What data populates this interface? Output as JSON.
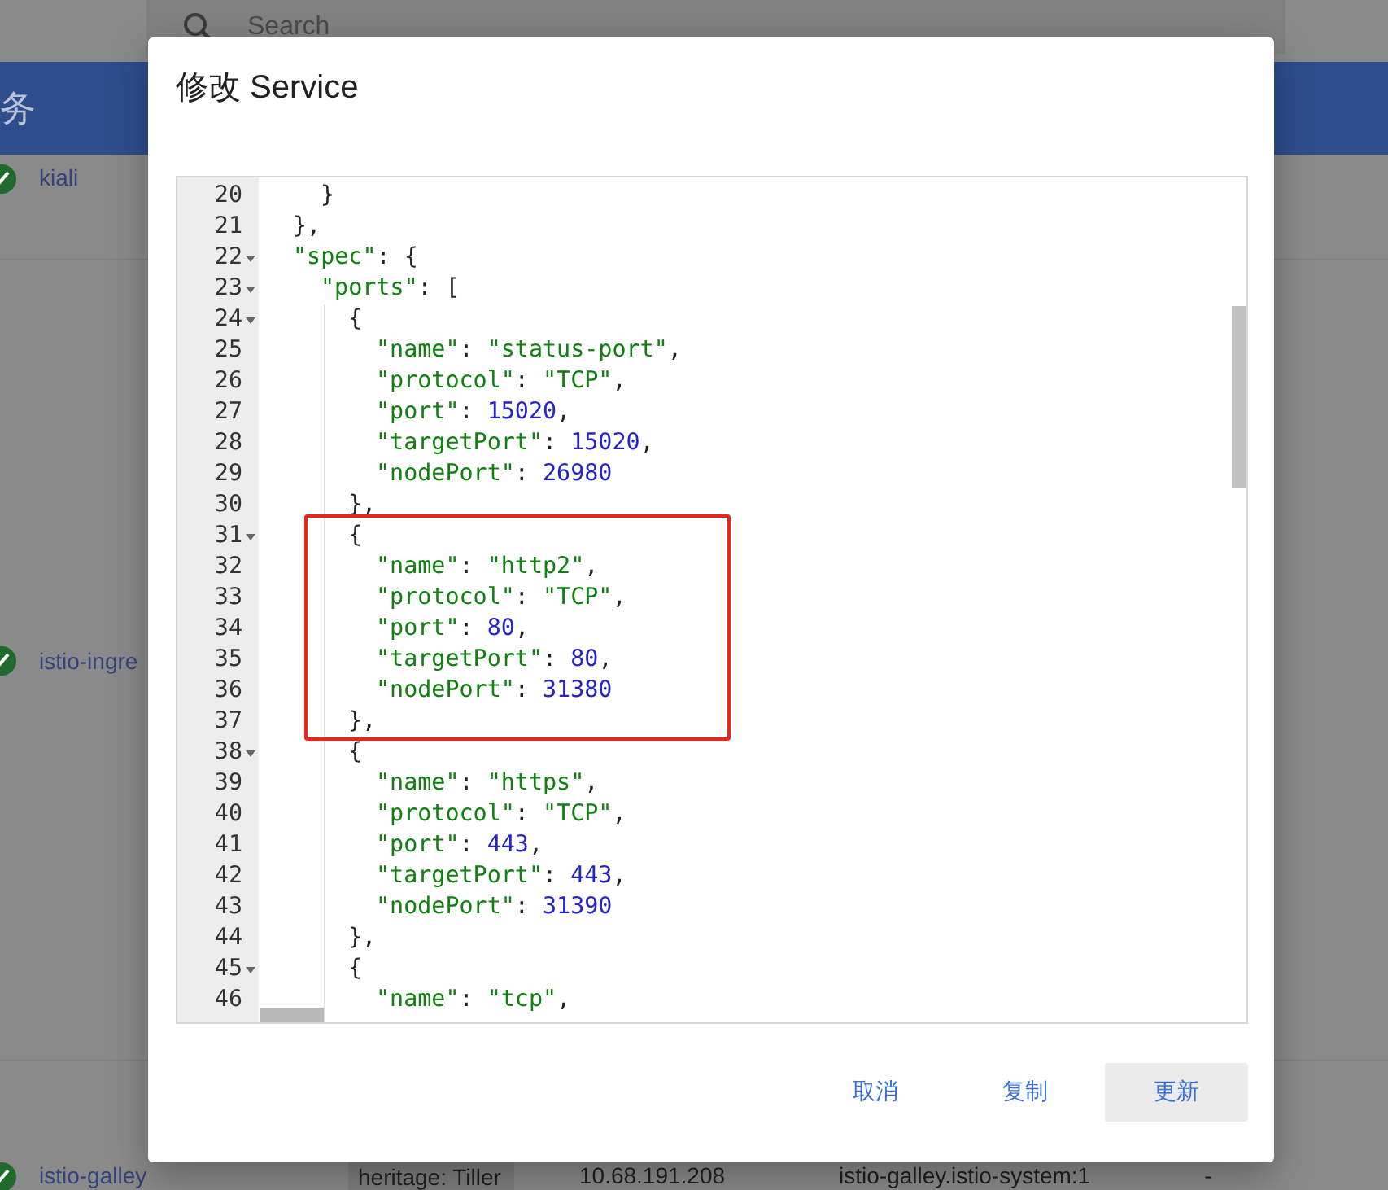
{
  "background": {
    "search": {
      "placeholder": "Search"
    },
    "header": {
      "title": "务"
    },
    "rows": [
      {
        "name": "kiali",
        "cells": []
      },
      {
        "name": "istio-ingre",
        "cells": []
      },
      {
        "name": "istio-galley",
        "cells": [
          {
            "kind": "tag",
            "text": "heritage: Tiller"
          },
          {
            "kind": "text",
            "text": "10.68.191.208"
          },
          {
            "kind": "text",
            "text": "istio-galley.istio-system:1"
          },
          {
            "kind": "text",
            "text": "-"
          }
        ]
      }
    ]
  },
  "dialog": {
    "title": "修改 Service",
    "editor": {
      "lines": [
        {
          "number": "20",
          "fold": false,
          "tokens": [
            {
              "kind": "punct",
              "text": "}"
            }
          ]
        },
        {
          "number": "21",
          "fold": false,
          "tokens": [
            {
              "kind": "punct",
              "text": "},"
            }
          ]
        },
        {
          "number": "22",
          "fold": true,
          "tokens": [
            {
              "kind": "key",
              "text": "\"spec\""
            },
            {
              "kind": "punct",
              "text": ": {"
            }
          ]
        },
        {
          "number": "23",
          "fold": true,
          "tokens": [
            {
              "kind": "key",
              "text": "\"ports\""
            },
            {
              "kind": "punct",
              "text": ": ["
            }
          ]
        },
        {
          "number": "24",
          "fold": true,
          "tokens": [
            {
              "kind": "punct",
              "text": "{"
            }
          ]
        },
        {
          "number": "25",
          "fold": false,
          "tokens": [
            {
              "kind": "key",
              "text": "\"name\""
            },
            {
              "kind": "punct",
              "text": ": "
            },
            {
              "kind": "string",
              "text": "\"status-port\""
            },
            {
              "kind": "punct",
              "text": ","
            }
          ]
        },
        {
          "number": "26",
          "fold": false,
          "tokens": [
            {
              "kind": "key",
              "text": "\"protocol\""
            },
            {
              "kind": "punct",
              "text": ": "
            },
            {
              "kind": "string",
              "text": "\"TCP\""
            },
            {
              "kind": "punct",
              "text": ","
            }
          ]
        },
        {
          "number": "27",
          "fold": false,
          "tokens": [
            {
              "kind": "key",
              "text": "\"port\""
            },
            {
              "kind": "punct",
              "text": ": "
            },
            {
              "kind": "number",
              "text": "15020"
            },
            {
              "kind": "punct",
              "text": ","
            }
          ]
        },
        {
          "number": "28",
          "fold": false,
          "tokens": [
            {
              "kind": "key",
              "text": "\"targetPort\""
            },
            {
              "kind": "punct",
              "text": ": "
            },
            {
              "kind": "number",
              "text": "15020"
            },
            {
              "kind": "punct",
              "text": ","
            }
          ]
        },
        {
          "number": "29",
          "fold": false,
          "tokens": [
            {
              "kind": "key",
              "text": "\"nodePort\""
            },
            {
              "kind": "punct",
              "text": ": "
            },
            {
              "kind": "number",
              "text": "26980"
            }
          ]
        },
        {
          "number": "30",
          "fold": false,
          "tokens": [
            {
              "kind": "punct",
              "text": "},"
            }
          ]
        },
        {
          "number": "31",
          "fold": true,
          "tokens": [
            {
              "kind": "punct",
              "text": "{"
            }
          ]
        },
        {
          "number": "32",
          "fold": false,
          "tokens": [
            {
              "kind": "key",
              "text": "\"name\""
            },
            {
              "kind": "punct",
              "text": ": "
            },
            {
              "kind": "string",
              "text": "\"http2\""
            },
            {
              "kind": "punct",
              "text": ","
            }
          ]
        },
        {
          "number": "33",
          "fold": false,
          "tokens": [
            {
              "kind": "key",
              "text": "\"protocol\""
            },
            {
              "kind": "punct",
              "text": ": "
            },
            {
              "kind": "string",
              "text": "\"TCP\""
            },
            {
              "kind": "punct",
              "text": ","
            }
          ]
        },
        {
          "number": "34",
          "fold": false,
          "tokens": [
            {
              "kind": "key",
              "text": "\"port\""
            },
            {
              "kind": "punct",
              "text": ": "
            },
            {
              "kind": "number",
              "text": "80"
            },
            {
              "kind": "punct",
              "text": ","
            }
          ]
        },
        {
          "number": "35",
          "fold": false,
          "tokens": [
            {
              "kind": "key",
              "text": "\"targetPort\""
            },
            {
              "kind": "punct",
              "text": ": "
            },
            {
              "kind": "number",
              "text": "80"
            },
            {
              "kind": "punct",
              "text": ","
            }
          ]
        },
        {
          "number": "36",
          "fold": false,
          "tokens": [
            {
              "kind": "key",
              "text": "\"nodePort\""
            },
            {
              "kind": "punct",
              "text": ": "
            },
            {
              "kind": "number",
              "text": "31380"
            }
          ]
        },
        {
          "number": "37",
          "fold": false,
          "tokens": [
            {
              "kind": "punct",
              "text": "},"
            }
          ]
        },
        {
          "number": "38",
          "fold": true,
          "tokens": [
            {
              "kind": "punct",
              "text": "{"
            }
          ]
        },
        {
          "number": "39",
          "fold": false,
          "tokens": [
            {
              "kind": "key",
              "text": "\"name\""
            },
            {
              "kind": "punct",
              "text": ": "
            },
            {
              "kind": "string",
              "text": "\"https\""
            },
            {
              "kind": "punct",
              "text": ","
            }
          ]
        },
        {
          "number": "40",
          "fold": false,
          "tokens": [
            {
              "kind": "key",
              "text": "\"protocol\""
            },
            {
              "kind": "punct",
              "text": ": "
            },
            {
              "kind": "string",
              "text": "\"TCP\""
            },
            {
              "kind": "punct",
              "text": ","
            }
          ]
        },
        {
          "number": "41",
          "fold": false,
          "tokens": [
            {
              "kind": "key",
              "text": "\"port\""
            },
            {
              "kind": "punct",
              "text": ": "
            },
            {
              "kind": "number",
              "text": "443"
            },
            {
              "kind": "punct",
              "text": ","
            }
          ]
        },
        {
          "number": "42",
          "fold": false,
          "tokens": [
            {
              "kind": "key",
              "text": "\"targetPort\""
            },
            {
              "kind": "punct",
              "text": ": "
            },
            {
              "kind": "number",
              "text": "443"
            },
            {
              "kind": "punct",
              "text": ","
            }
          ]
        },
        {
          "number": "43",
          "fold": false,
          "tokens": [
            {
              "kind": "key",
              "text": "\"nodePort\""
            },
            {
              "kind": "punct",
              "text": ": "
            },
            {
              "kind": "number",
              "text": "31390"
            }
          ]
        },
        {
          "number": "44",
          "fold": false,
          "tokens": [
            {
              "kind": "punct",
              "text": "},"
            }
          ]
        },
        {
          "number": "45",
          "fold": true,
          "tokens": [
            {
              "kind": "punct",
              "text": "{"
            }
          ]
        },
        {
          "number": "46",
          "fold": false,
          "tokens": [
            {
              "kind": "key",
              "text": "\"name\""
            },
            {
              "kind": "punct",
              "text": ": "
            },
            {
              "kind": "string",
              "text": "\"tcp\""
            },
            {
              "kind": "punct",
              "text": ","
            }
          ]
        }
      ]
    },
    "buttons": [
      {
        "label": "取消",
        "kind": "text"
      },
      {
        "label": "复制",
        "kind": "text"
      },
      {
        "label": "更新",
        "kind": "filled"
      }
    ]
  }
}
